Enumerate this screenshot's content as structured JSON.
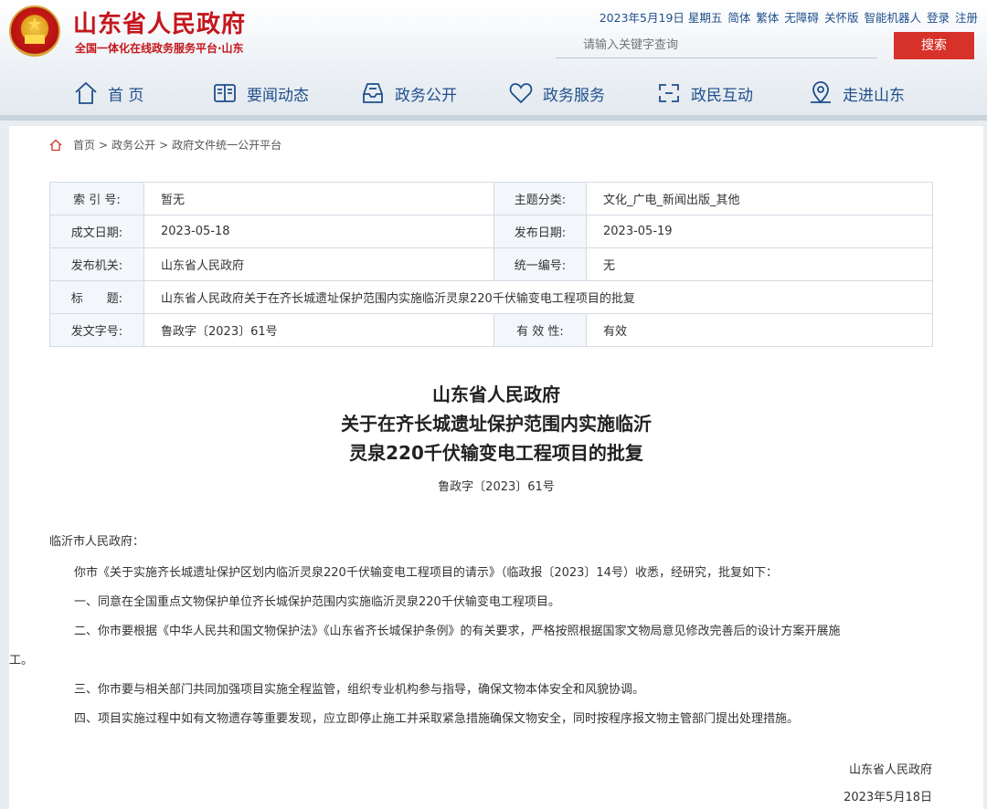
{
  "header": {
    "site_title": "山东省人民政府",
    "site_subtitle": "全国一体化在线政务服务平台·山东",
    "date": "2023年5月19日 星期五",
    "toplinks": [
      "简体",
      "繁体",
      "无障碍",
      "关怀版",
      "智能机器人",
      "登录",
      "注册"
    ],
    "search_placeholder": "请输入关键字查询",
    "search_button": "搜索",
    "colors": {
      "brand_red": "#c4161c",
      "nav_blue": "#1f4f8c",
      "button_red": "#d7322a"
    }
  },
  "nav": [
    {
      "label": "首 页",
      "icon": "home-icon"
    },
    {
      "label": "要闻动态",
      "icon": "news-icon"
    },
    {
      "label": "政务公开",
      "icon": "inbox-icon"
    },
    {
      "label": "政务服务",
      "icon": "heart-icon"
    },
    {
      "label": "政民互动",
      "icon": "interaction-icon"
    },
    {
      "label": "走进山东",
      "icon": "location-icon"
    }
  ],
  "breadcrumb": {
    "icon": "home-icon",
    "items": [
      "首页",
      "政务公开",
      "政府文件统一公开平台"
    ],
    "separator": ">"
  },
  "meta": {
    "index_label": "索 引 号:",
    "index_value": "暂无",
    "topic_label": "主题分类:",
    "topic_value": "文化_广电_新闻出版_其他",
    "written_label": "成文日期:",
    "written_value": "2023-05-18",
    "published_label": "发布日期:",
    "published_value": "2023-05-19",
    "org_label": "发布机关:",
    "org_value": "山东省人民政府",
    "uid_label": "统一编号:",
    "uid_value": "无",
    "title_label": "标　　题:",
    "title_value": "山东省人民政府关于在齐长城遗址保护范围内实施临沂灵泉220千伏输变电工程项目的批复",
    "docno_label": "发文字号:",
    "docno_value": "鲁政字〔2023〕61号",
    "validity_label": "有 效 性:",
    "validity_value": "有效"
  },
  "document": {
    "title_line1": "山东省人民政府",
    "title_line2": "关于在齐长城遗址保护范围内实施临沂",
    "title_line3": "灵泉220千伏输变电工程项目的批复",
    "number": "鲁政字〔2023〕61号",
    "salutation": "临沂市人民政府：",
    "para1": "你市《关于实施齐长城遗址保护区划内临沂灵泉220千伏输变电工程项目的请示》（临政报〔2023〕14号）收悉，经研究，批复如下：",
    "para2": "一、同意在全国重点文物保护单位齐长城保护范围内实施临沂灵泉220千伏输变电工程项目。",
    "para3a": "二、你市要根据《中华人民共和国文物保护法》《山东省齐长城保护条例》的有关要求，严格按照根据国家文物局意见修改完善后的设计方案开展施",
    "para3b": "工。",
    "para4": "三、你市要与相关部门共同加强项目实施全程监管，组织专业机构参与指导，确保文物本体安全和风貌协调。",
    "para5": "四、项目实施过程中如有文物遗存等重要发现，应立即停止施工并采取紧急措施确保文物安全，同时按程序报文物主管部门提出处理措施。",
    "sign_org": "山东省人民政府",
    "sign_date": "2023年5月18日"
  }
}
